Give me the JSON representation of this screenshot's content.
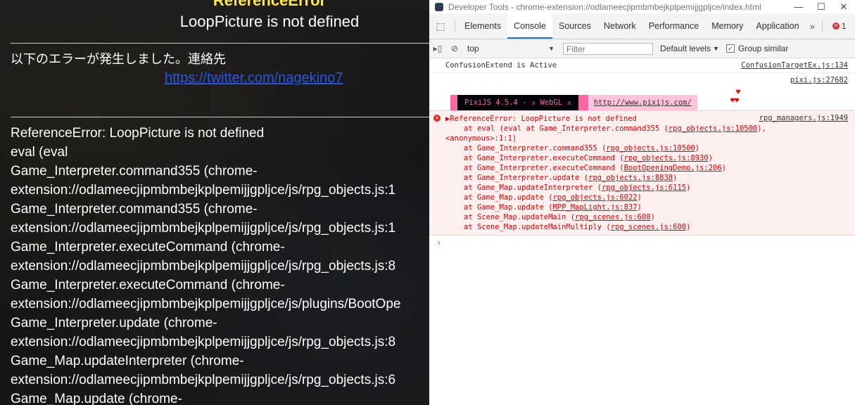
{
  "game": {
    "error_title": "ReferenceError",
    "error_message": "LoopPicture is not defined",
    "contact_text": "以下のエラーが発生しました。連絡先",
    "contact_link": "https://twitter.com/nagekino7",
    "stack_lines": [
      "ReferenceError: LoopPicture is not defined",
      "eval (eval",
      "Game_Interpreter.command355 (chrome-",
      "extension://odlameecjipmbmbejkplpemijjgpljce/js/rpg_objects.js:1",
      "Game_Interpreter.command355 (chrome-",
      "extension://odlameecjipmbmbejkplpemijjgpljce/js/rpg_objects.js:1",
      "Game_Interpreter.executeCommand (chrome-",
      "extension://odlameecjipmbmbejkplpemijjgpljce/js/rpg_objects.js:8",
      "Game_Interpreter.executeCommand (chrome-",
      "extension://odlameecjipmbmbejkplpemijjgpljce/js/plugins/BootOpe",
      "Game_Interpreter.update (chrome-",
      "extension://odlameecjipmbmbejkplpemijjgpljce/js/rpg_objects.js:8",
      "Game_Map.updateInterpreter (chrome-",
      "extension://odlameecjipmbmbejkplpemijjgpljce/js/rpg_objects.js:6",
      "Game_Map.update (chrome-"
    ],
    "colors": {
      "title": "#ffe84a",
      "link": "#2a56e0"
    }
  },
  "devtools": {
    "window_title": "Developer Tools - chrome-extension://odlameecjipmbmbejkplpemijjgpljce/index.html",
    "window_controls": {
      "minimize": "—",
      "maximize": "☐",
      "close": "✕"
    },
    "tabs": [
      "Elements",
      "Console",
      "Sources",
      "Network",
      "Performance",
      "Memory",
      "Application"
    ],
    "active_tab": "Console",
    "more_tabs": "»",
    "error_count": "1",
    "toolbar": {
      "context": "top",
      "filter_placeholder": "Filter",
      "levels": "Default levels",
      "group_similar": "Group similar"
    },
    "messages": {
      "confusion": {
        "text": "ConfusionExtend is Active",
        "source": "ConfusionTargetEx.js:134"
      },
      "pixi": {
        "source": "pixi.js:27682",
        "banner": "PixiJS 4.5.4 - ✰ WebGL ✰",
        "link": "http://www.pixijs.com/",
        "hearts_top": "♥",
        "hearts_bottom": "♥♥"
      },
      "error": {
        "source": "rpg_managers.js:1949",
        "summary": "ReferenceError: LoopPicture is not defined",
        "eval_line_pre": "at eval (eval at Game_Interpreter.command355 (",
        "eval_line_link": "rpg_objects.js:10500",
        "eval_line_post": "),",
        "anon_line": "<anonymous>:1:1)",
        "frames": [
          {
            "fn": "at Game_Interpreter.command355 (",
            "loc": "rpg_objects.js:10500"
          },
          {
            "fn": "at Game_Interpreter.executeCommand (",
            "loc": "rpg_objects.js:8930"
          },
          {
            "fn": "at Game_Interpreter.executeCommand (",
            "loc": "BootOpeningDemo.js:206"
          },
          {
            "fn": "at Game_Interpreter.update (",
            "loc": "rpg_objects.js:8838"
          },
          {
            "fn": "at Game_Map.updateInterpreter (",
            "loc": "rpg_objects.js:6115"
          },
          {
            "fn": "at Game_Map.update (",
            "loc": "rpg_objects.js:6022"
          },
          {
            "fn": "at Game_Map.update (",
            "loc": "MPP_MapLight.js:837"
          },
          {
            "fn": "at Scene_Map.updateMain (",
            "loc": "rpg_scenes.js:608"
          },
          {
            "fn": "at Scene_Map.updateMainMultiply (",
            "loc": "rpg_scenes.js:600"
          }
        ]
      }
    },
    "prompt": "›"
  }
}
